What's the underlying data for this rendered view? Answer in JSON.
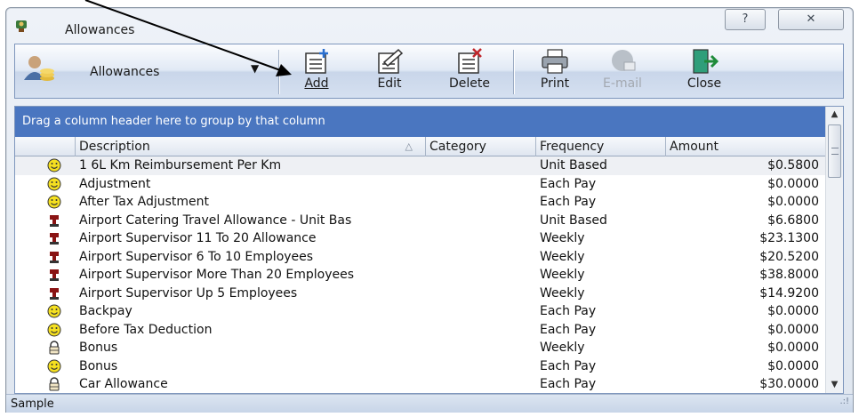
{
  "window": {
    "title": "Allowances",
    "help_glyph": "?",
    "close_glyph": "✕"
  },
  "toolbar": {
    "view_label": "Allowances",
    "view_dropdown_glyph": "▼",
    "add_label": "Add",
    "edit_label": "Edit",
    "delete_label": "Delete",
    "print_label": "Print",
    "email_label": "E-mail",
    "close_label": "Close"
  },
  "grid": {
    "group_by_hint": "Drag a column header here to group by that column",
    "columns": {
      "description": "Description",
      "category": "Category",
      "frequency": "Frequency",
      "amount": "Amount"
    },
    "sort_glyph": "△",
    "rows": [
      {
        "icon": "smiley-icon",
        "description": "1 6L Km Reimbursement Per Km",
        "category": "",
        "frequency": "Unit Based",
        "amount": "$0.5800"
      },
      {
        "icon": "smiley-icon",
        "description": "Adjustment",
        "category": "",
        "frequency": "Each Pay",
        "amount": "$0.0000"
      },
      {
        "icon": "smiley-icon",
        "description": "After Tax Adjustment",
        "category": "",
        "frequency": "Each Pay",
        "amount": "$0.0000"
      },
      {
        "icon": "award-icon",
        "description": "Airport Catering Travel Allowance - Unit Bas",
        "category": "",
        "frequency": "Unit Based",
        "amount": "$6.6800"
      },
      {
        "icon": "award-icon",
        "description": "Airport Supervisor 11 To 20 Allowance",
        "category": "",
        "frequency": "Weekly",
        "amount": "$23.1300"
      },
      {
        "icon": "award-icon",
        "description": "Airport Supervisor 6 To 10 Employees",
        "category": "",
        "frequency": "Weekly",
        "amount": "$20.5200"
      },
      {
        "icon": "award-icon",
        "description": "Airport Supervisor More Than 20 Employees",
        "category": "",
        "frequency": "Weekly",
        "amount": "$38.8000"
      },
      {
        "icon": "award-icon",
        "description": "Airport Supervisor Up 5 Employees",
        "category": "",
        "frequency": "Weekly",
        "amount": "$14.9200"
      },
      {
        "icon": "smiley-icon",
        "description": "Backpay",
        "category": "",
        "frequency": "Each Pay",
        "amount": "$0.0000"
      },
      {
        "icon": "smiley-icon",
        "description": "Before Tax Deduction",
        "category": "",
        "frequency": "Each Pay",
        "amount": "$0.0000"
      },
      {
        "icon": "lock-icon",
        "description": "Bonus",
        "category": "",
        "frequency": "Weekly",
        "amount": "$0.0000"
      },
      {
        "icon": "smiley-icon",
        "description": "Bonus",
        "category": "",
        "frequency": "Each Pay",
        "amount": "$0.0000"
      },
      {
        "icon": "lock-icon",
        "description": "Car Allowance",
        "category": "",
        "frequency": "Each Pay",
        "amount": "$30.0000"
      }
    ]
  },
  "scrollbar": {
    "up_glyph": "▲",
    "down_glyph": "▼"
  },
  "status": {
    "text": "Sample",
    "grip_glyph": ".:!"
  },
  "colors": {
    "group_bar": "#4a76c0",
    "smiley": "#f5e020",
    "award": "#8a1414",
    "accent_border": "#7f97bd"
  }
}
